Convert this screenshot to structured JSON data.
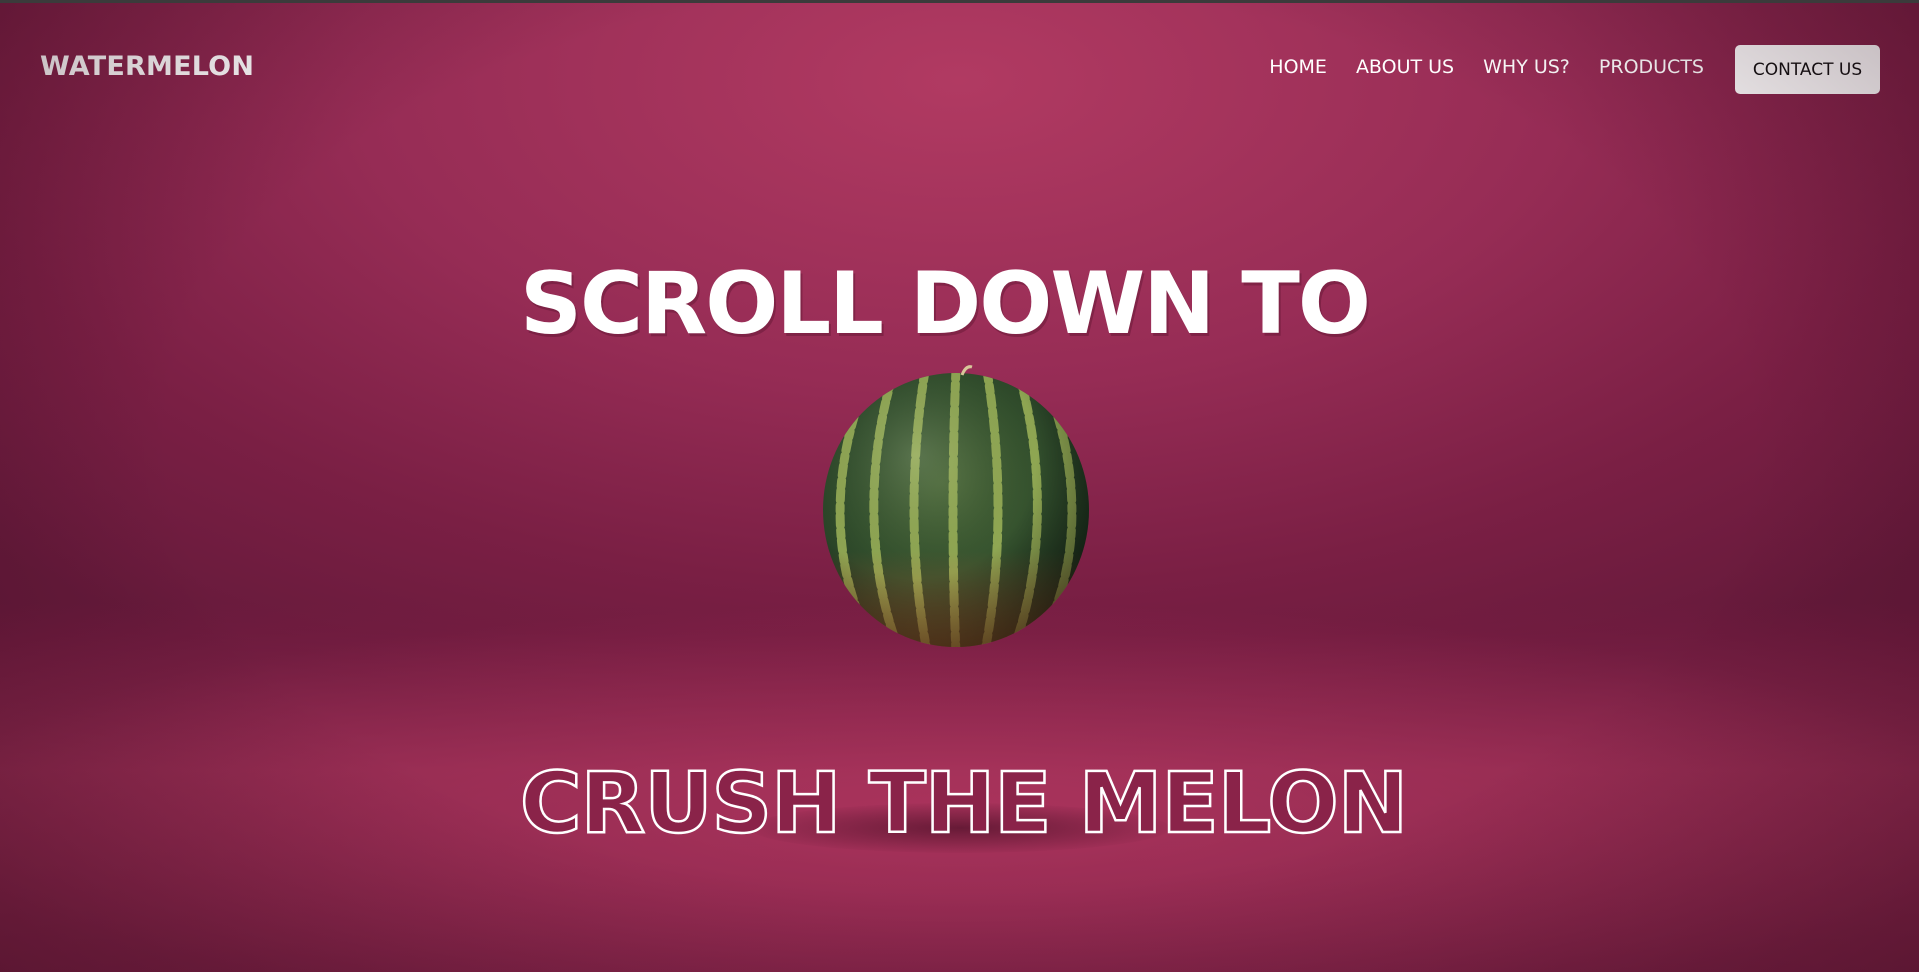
{
  "brand": {
    "logo": "WATERMELON"
  },
  "nav": {
    "items": [
      {
        "label": "HOME"
      },
      {
        "label": "ABOUT US"
      },
      {
        "label": "WHY US?"
      },
      {
        "label": "PRODUCTS"
      }
    ],
    "contact_label": "CONTACT US"
  },
  "hero": {
    "headline_top": "SCROLL DOWN TO",
    "headline_bottom": "CRUSH THE MELON",
    "image": "watermelon-image"
  },
  "colors": {
    "background": "#962c55",
    "text": "#ffffff",
    "outline_fill": "#8a2349",
    "button_bg": "#ffffff",
    "button_text": "#111111"
  }
}
